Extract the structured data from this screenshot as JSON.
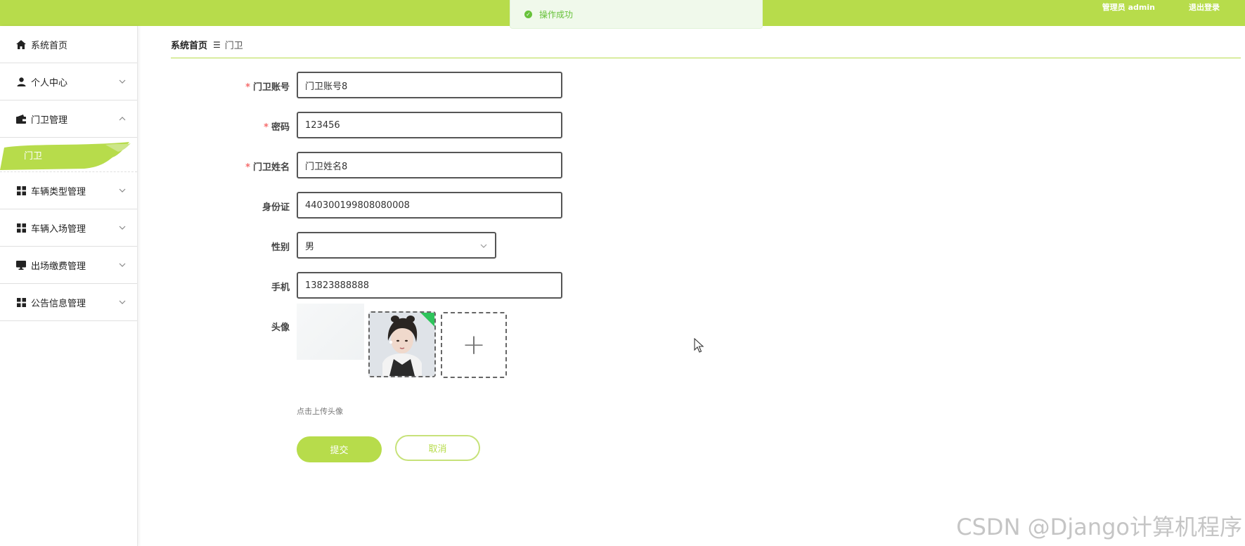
{
  "header": {
    "user_label": "管理员 admin",
    "logout_label": "退出登录",
    "bar_color": "#b7dc4b"
  },
  "toast": {
    "message": "操作成功",
    "icon": "check-circle-icon",
    "color": "#67c23a"
  },
  "sidebar": {
    "items": [
      {
        "label": "系统首页",
        "icon": "home-icon"
      },
      {
        "label": "个人中心",
        "icon": "user-icon"
      },
      {
        "label": "门卫管理",
        "icon": "wallet-icon",
        "expanded": true,
        "children": [
          {
            "label": "门卫",
            "active": true
          }
        ]
      },
      {
        "label": "车辆类型管理",
        "icon": "grid-icon"
      },
      {
        "label": "车辆入场管理",
        "icon": "grid-icon"
      },
      {
        "label": "出场缴费管理",
        "icon": "monitor-icon"
      },
      {
        "label": "公告信息管理",
        "icon": "grid-icon"
      }
    ]
  },
  "breadcrumb": {
    "home": "系统首页",
    "separator": "☰",
    "current": "门卫"
  },
  "form": {
    "account": {
      "label": "门卫账号",
      "required": true,
      "value": "门卫账号8"
    },
    "password": {
      "label": "密码",
      "required": true,
      "value": "123456"
    },
    "name": {
      "label": "门卫姓名",
      "required": true,
      "value": "门卫姓名8"
    },
    "id_card": {
      "label": "身份证",
      "required": false,
      "value": "440300199808080008"
    },
    "gender": {
      "label": "性别",
      "required": false,
      "value": "男"
    },
    "phone": {
      "label": "手机",
      "required": false,
      "value": "13823888888"
    },
    "avatar": {
      "label": "头像",
      "hint": "点击上传头像"
    },
    "submit_label": "提交",
    "cancel_label": "取消"
  },
  "watermark": "CSDN @Django计算机程序"
}
